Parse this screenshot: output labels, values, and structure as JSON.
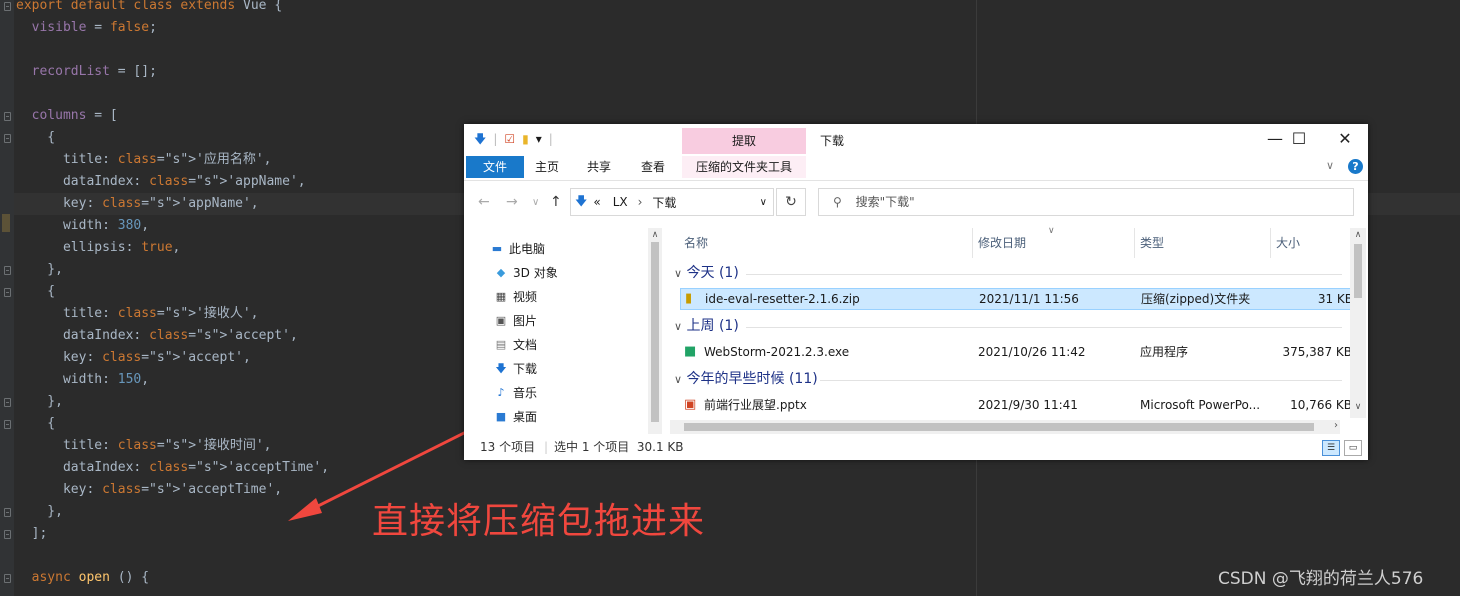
{
  "editor": {
    "lines": [
      "export default class extends Vue {",
      "  visible = false;",
      "",
      "  recordList = [];",
      "",
      "  columns = [",
      "    {",
      "      title: '应用名称',",
      "      dataIndex: 'appName',",
      "      key: 'appName',",
      "      width: 380,",
      "      ellipsis: true,",
      "    },",
      "    {",
      "      title: '接收人',",
      "      dataIndex: 'accept',",
      "      key: 'accept',",
      "      width: 150,",
      "    },",
      "    {",
      "      title: '接收时间',",
      "      dataIndex: 'acceptTime',",
      "      key: 'acceptTime',",
      "    },",
      "  ];",
      "",
      "  async open () {"
    ]
  },
  "annotation": {
    "text": "直接将压缩包拖进来",
    "color": "#f0473e"
  },
  "watermark": "CSDN @飞翔的荷兰人576",
  "explorer": {
    "context_tab_header": "提取",
    "window_title": "下载",
    "controls": {
      "minimize": "—",
      "maximize": "☐",
      "close": "✕"
    },
    "ribbon_tabs": [
      "文件",
      "主页",
      "共享",
      "查看",
      "压缩的文件夹工具"
    ],
    "address": {
      "prefix": "«",
      "segments": [
        "LX",
        "下载"
      ]
    },
    "search_placeholder": "搜索\"下载\"",
    "nav_items": [
      "此电脑",
      "3D 对象",
      "视频",
      "图片",
      "文档",
      "下载",
      "音乐",
      "桌面"
    ],
    "columns": [
      "名称",
      "修改日期",
      "类型",
      "大小"
    ],
    "groups": [
      {
        "label": "今天 (1)",
        "files": [
          {
            "name": "ide-eval-resetter-2.1.6.zip",
            "date": "2021/11/1 11:56",
            "type": "压缩(zipped)文件夹",
            "size": "31 KB",
            "selected": true
          }
        ]
      },
      {
        "label": "上周 (1)",
        "files": [
          {
            "name": "WebStorm-2021.2.3.exe",
            "date": "2021/10/26 11:42",
            "type": "应用程序",
            "size": "375,387 KB",
            "selected": false
          }
        ]
      },
      {
        "label": "今年的早些时候 (11)",
        "files": [
          {
            "name": "前端行业展望.pptx",
            "date": "2021/9/30 11:41",
            "type": "Microsoft PowerPo...",
            "size": "10,766 KB",
            "selected": false
          }
        ]
      }
    ],
    "status": {
      "count": "13 个项目",
      "selection": "选中 1 个项目  30.1 KB"
    }
  }
}
